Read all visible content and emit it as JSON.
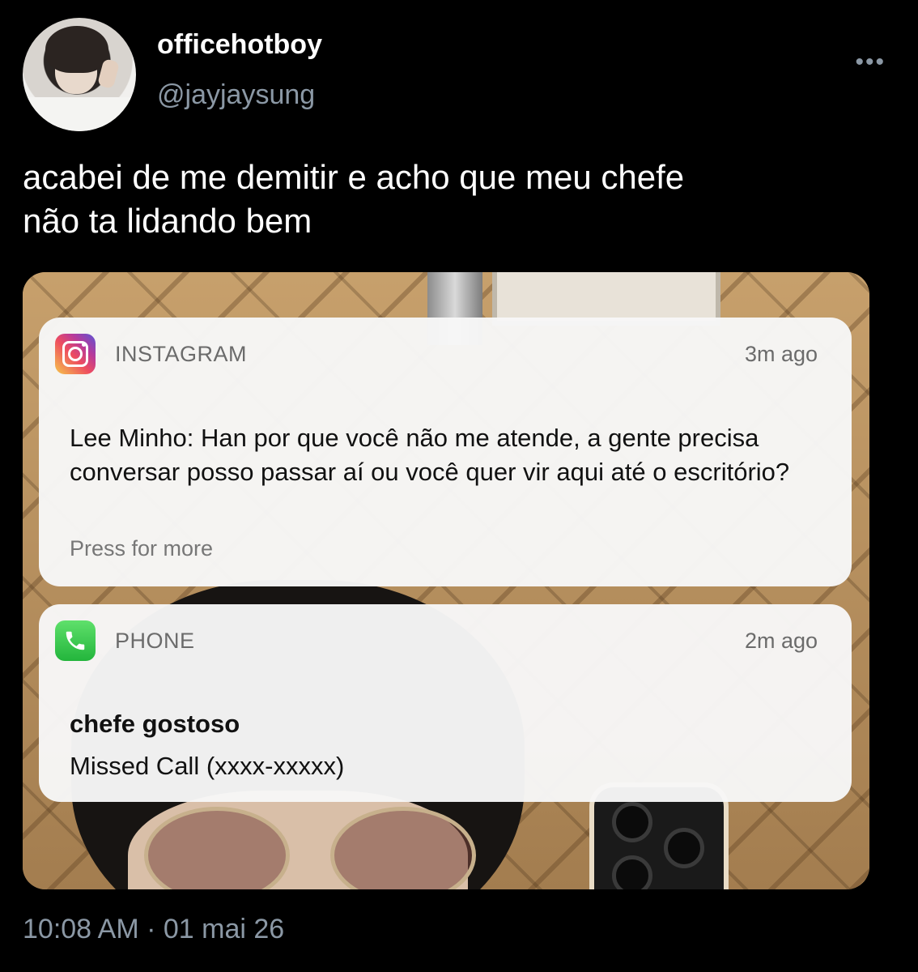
{
  "user": {
    "display_name": "officehotboy",
    "handle": "@jayjaysung"
  },
  "tweet": {
    "text_line1": "acabei de me demitir e acho que meu chefe",
    "text_line2": "não ta lidando bem",
    "timestamp": "10:08 AM · 01 mai 26"
  },
  "notifications": [
    {
      "app": "INSTAGRAM",
      "icon": "instagram-icon",
      "time": "3m ago",
      "message": "Lee Minho: Han por que você não me atende, a gente precisa conversar posso passar aí ou você quer vir aqui até o escritório?",
      "hint": "Press for more"
    },
    {
      "app": "PHONE",
      "icon": "phone-icon",
      "time": "2m ago",
      "title": "chefe gostoso",
      "subtitle": "Missed Call (xxxx-xxxxx)"
    }
  ],
  "colors": {
    "background": "#000000",
    "secondary_text": "#8b98a5",
    "notification_bg": "#f7f7f7"
  }
}
